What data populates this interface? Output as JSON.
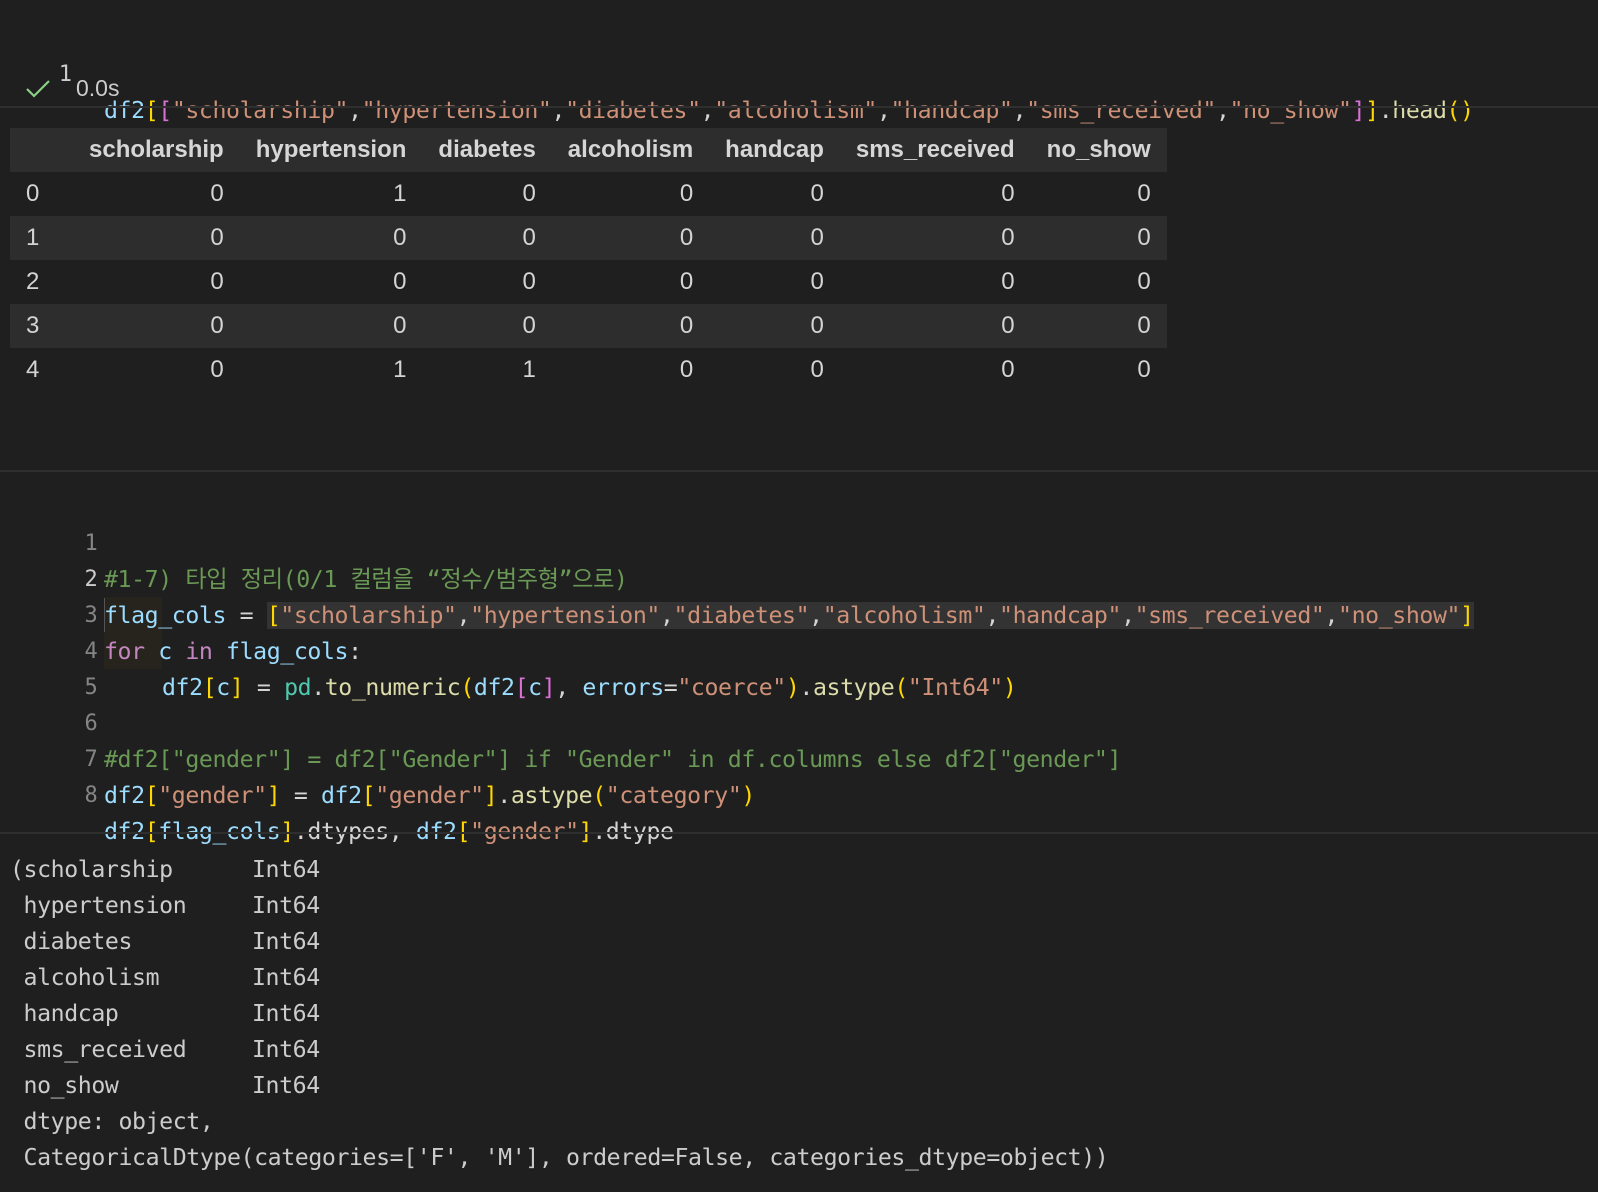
{
  "cell1": {
    "line_number": "1",
    "code": {
      "t1": "df2",
      "t2": "[",
      "t3": "[",
      "cols": [
        "\"scholarship\"",
        "\"hypertension\"",
        "\"diabetes\"",
        "\"alcoholism\"",
        "\"handcap\"",
        "\"sms_received\"",
        "\"no_show\""
      ],
      "comma": ",",
      "t4": "]",
      "t5": "]",
      "t6": ".",
      "t7": "head",
      "t8": "()"
    },
    "status_time": "0.0s",
    "status_color": "#89d185"
  },
  "table": {
    "headers": [
      "",
      "scholarship",
      "hypertension",
      "diabetes",
      "alcoholism",
      "handcap",
      "sms_received",
      "no_show"
    ],
    "rows": [
      [
        "0",
        "0",
        "1",
        "0",
        "0",
        "0",
        "0",
        "0"
      ],
      [
        "1",
        "0",
        "0",
        "0",
        "0",
        "0",
        "0",
        "0"
      ],
      [
        "2",
        "0",
        "0",
        "0",
        "0",
        "0",
        "0",
        "0"
      ],
      [
        "3",
        "0",
        "0",
        "0",
        "0",
        "0",
        "0",
        "0"
      ],
      [
        "4",
        "0",
        "1",
        "1",
        "0",
        "0",
        "0",
        "0"
      ]
    ]
  },
  "cell2": {
    "line_numbers": [
      "1",
      "2",
      "3",
      "4",
      "5",
      "6",
      "7",
      "8"
    ],
    "l1": "#1-7) 타입 정리(0/1 컬럼을 “정수/범주형”으로)",
    "l2": {
      "a": "flag_cols",
      "b": " = ",
      "c": "[",
      "cols": [
        "\"scholarship\"",
        "\"hypertension\"",
        "\"diabetes\"",
        "\"alcoholism\"",
        "\"handcap\"",
        "\"sms_received\"",
        "\"no_show\""
      ],
      "comma": ",",
      "d": "]"
    },
    "l3": {
      "a": "for",
      "b": " c ",
      "c": "in",
      "d": " flag_cols",
      "e": ":"
    },
    "l4": {
      "a": "df2",
      "b": "[",
      "c": "c",
      "d": "]",
      "e": " = ",
      "f": "pd",
      "g": ".",
      "h": "to_numeric",
      "i": "(",
      "j": "df2",
      "k": "[",
      "l": "c",
      "m": "]",
      "n": ", ",
      "o": "errors",
      "p": "=",
      "q": "\"coerce\"",
      "r": ")",
      "s": ".",
      "t": "astype",
      "u": "(",
      "v": "\"Int64\"",
      "w": ")"
    },
    "l6": "#df2[\"gender\"] = df2[\"Gender\"] if \"Gender\" in df.columns else df2[\"gender\"]",
    "l7": {
      "a": "df2",
      "b": "[",
      "c": "\"gender\"",
      "d": "]",
      "e": " = ",
      "f": "df2",
      "g": "[",
      "h": "\"gender\"",
      "i": "]",
      "j": ".",
      "k": "astype",
      "l": "(",
      "m": "\"category\"",
      "n": ")"
    },
    "l8": {
      "a": "df2",
      "b": "[",
      "c": "flag_cols",
      "d": "]",
      "e": ".",
      "f": "dtypes",
      "g": ", ",
      "h": "df2",
      "i": "[",
      "j": "\"gender\"",
      "k": "]",
      "l": ".",
      "m": "dtype"
    }
  },
  "output": {
    "rows": [
      {
        "name": "(scholarship",
        "type": "Int64"
      },
      {
        "name": " hypertension",
        "type": "Int64"
      },
      {
        "name": " diabetes",
        "type": "Int64"
      },
      {
        "name": " alcoholism",
        "type": "Int64"
      },
      {
        "name": " handcap",
        "type": "Int64"
      },
      {
        "name": " sms_received",
        "type": "Int64"
      },
      {
        "name": " no_show",
        "type": "Int64"
      }
    ],
    "dtype_line": " dtype: object,",
    "cat_line": " CategoricalDtype(categories=['F', 'M'], ordered=False, categories_dtype=object))"
  }
}
